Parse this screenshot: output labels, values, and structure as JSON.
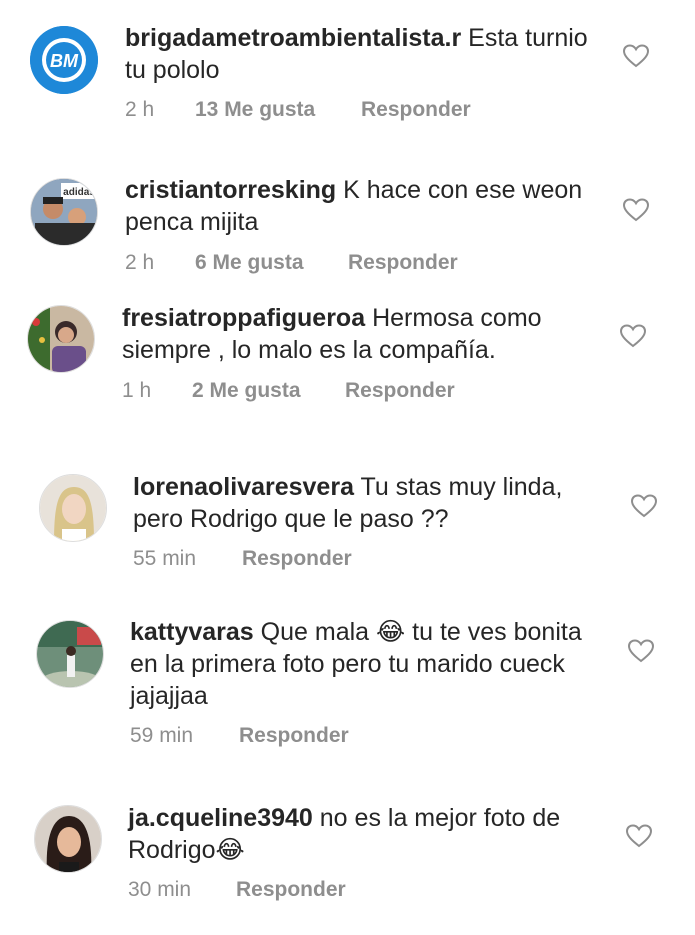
{
  "comments": [
    {
      "username": "brigadametroambientalista.r",
      "text": "Esta turnio tu pololo",
      "time": "2 h",
      "likes": "13 Me gusta",
      "reply": "Responder",
      "avatar_initials": "BM"
    },
    {
      "username": "cristiantorresking",
      "text": "K hace con ese weon penca mijita",
      "time": "2 h",
      "likes": "6 Me gusta",
      "reply": "Responder",
      "avatar_logo": "adidas"
    },
    {
      "username": "fresiatroppafigueroa",
      "text": "Hermosa como siempre , lo malo es la compañía.",
      "time": "1 h",
      "likes": "2 Me gusta",
      "reply": "Responder"
    },
    {
      "username": "lorenaolivaresvera",
      "text": "Tu stas muy linda, pero Rodrigo que le paso ??",
      "time": "55 min",
      "likes": "",
      "reply": "Responder"
    },
    {
      "username": "kattyvaras",
      "text": "Que mala 😂 tu te ves bonita en la primera foto pero tu marido cueck jajajjaa",
      "time": "59 min",
      "likes": "",
      "reply": "Responder"
    },
    {
      "username": "ja.cqueline3940",
      "text": "no es la mejor foto de Rodrigo😂",
      "time": "30 min",
      "likes": "",
      "reply": "Responder"
    }
  ],
  "icons": {
    "like": "heart-outline-icon"
  },
  "colors": {
    "text": "#262626",
    "meta": "#8e8e8e",
    "brand_avatar": "#1e88d8"
  }
}
